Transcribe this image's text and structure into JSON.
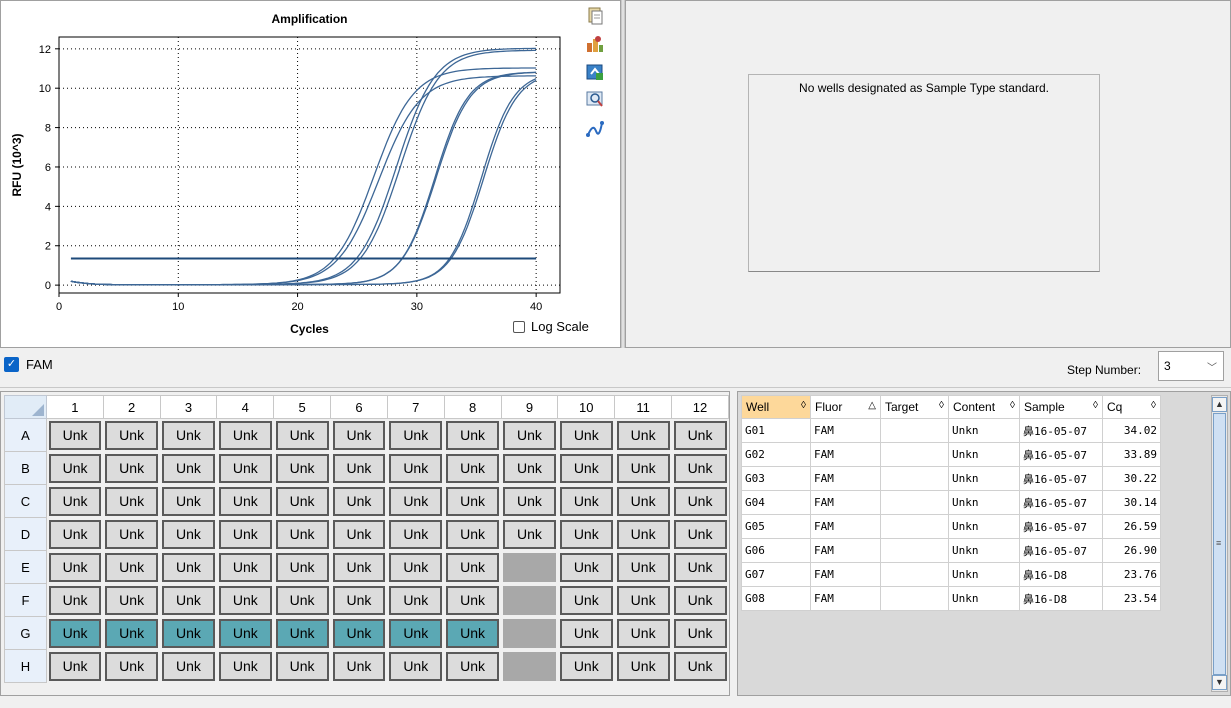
{
  "chart_data": {
    "type": "line",
    "title": "Amplification",
    "xlabel": "Cycles",
    "ylabel": "RFU (10^3)",
    "xlim": [
      0,
      42
    ],
    "ylim": [
      -0.4,
      12.6
    ],
    "xticks": [
      0,
      10,
      20,
      30,
      40
    ],
    "yticks": [
      0,
      2,
      4,
      6,
      8,
      10,
      12
    ],
    "grid": true,
    "threshold": 1.35,
    "series": [
      {
        "well": "G01",
        "cq": 34.02,
        "plateau": 10.8,
        "mid": 35.6,
        "k": 0.72
      },
      {
        "well": "G02",
        "cq": 33.89,
        "plateau": 10.8,
        "mid": 35.4,
        "k": 0.74
      },
      {
        "well": "G03",
        "cq": 30.22,
        "plateau": 10.8,
        "mid": 31.6,
        "k": 0.7
      },
      {
        "well": "G04",
        "cq": 30.14,
        "plateau": 10.8,
        "mid": 31.5,
        "k": 0.72
      },
      {
        "well": "G05",
        "cq": 26.59,
        "plateau": 12.0,
        "mid": 28.3,
        "k": 0.62
      },
      {
        "well": "G06",
        "cq": 26.9,
        "plateau": 11.9,
        "mid": 28.6,
        "k": 0.62
      },
      {
        "well": "G07",
        "cq": 23.76,
        "plateau": 11.0,
        "mid": 26.4,
        "k": 0.6
      },
      {
        "well": "G08",
        "cq": 23.54,
        "plateau": 10.6,
        "mid": 26.8,
        "k": 0.58
      }
    ],
    "colors": {
      "curve": "#3d6796",
      "threshold": "#1e4a7a",
      "grid": "#000000"
    }
  },
  "chart_panel": {
    "log_scale_label": "Log Scale",
    "log_scale_checked": false,
    "tool_icons": [
      "copy-icon",
      "export-icon",
      "refresh-icon",
      "zoom-icon",
      "curve-icon"
    ]
  },
  "standard_panel": {
    "message": "No wells designated as Sample Type standard."
  },
  "fluor_bar": {
    "fluor_label": "FAM",
    "fluor_checked": true,
    "step_label": "Step Number:",
    "step_value": "3"
  },
  "plate": {
    "columns": [
      "1",
      "2",
      "3",
      "4",
      "5",
      "6",
      "7",
      "8",
      "9",
      "10",
      "11",
      "12"
    ],
    "rows": [
      "A",
      "B",
      "C",
      "D",
      "E",
      "F",
      "G",
      "H"
    ],
    "well_label": "Unk",
    "empty_wells": [
      "E9",
      "F9",
      "G9",
      "H9"
    ],
    "selected_wells": [
      "G1",
      "G2",
      "G3",
      "G4",
      "G5",
      "G6",
      "G7",
      "G8"
    ],
    "colors": {
      "well": "#dcdcdc",
      "selected": "#5ba8b4",
      "empty": "#a8a8a8"
    }
  },
  "grid": {
    "headers": [
      {
        "label": "Well",
        "sort": "◊",
        "active": true
      },
      {
        "label": "Fluor",
        "sort": "△",
        "active": false
      },
      {
        "label": "Target",
        "sort": "◊",
        "active": false
      },
      {
        "label": "Content",
        "sort": "◊",
        "active": false
      },
      {
        "label": "Sample",
        "sort": "◊",
        "active": false
      },
      {
        "label": "Cq",
        "sort": "◊",
        "active": false
      }
    ],
    "rows": [
      {
        "well": "G01",
        "fluor": "FAM",
        "target": "",
        "content": "Unkn",
        "sample": "鼻16-05-07",
        "cq": "34.02"
      },
      {
        "well": "G02",
        "fluor": "FAM",
        "target": "",
        "content": "Unkn",
        "sample": "鼻16-05-07",
        "cq": "33.89"
      },
      {
        "well": "G03",
        "fluor": "FAM",
        "target": "",
        "content": "Unkn",
        "sample": "鼻16-05-07",
        "cq": "30.22"
      },
      {
        "well": "G04",
        "fluor": "FAM",
        "target": "",
        "content": "Unkn",
        "sample": "鼻16-05-07",
        "cq": "30.14"
      },
      {
        "well": "G05",
        "fluor": "FAM",
        "target": "",
        "content": "Unkn",
        "sample": "鼻16-05-07",
        "cq": "26.59"
      },
      {
        "well": "G06",
        "fluor": "FAM",
        "target": "",
        "content": "Unkn",
        "sample": "鼻16-05-07",
        "cq": "26.90"
      },
      {
        "well": "G07",
        "fluor": "FAM",
        "target": "",
        "content": "Unkn",
        "sample": "鼻16-D8",
        "cq": "23.76"
      },
      {
        "well": "G08",
        "fluor": "FAM",
        "target": "",
        "content": "Unkn",
        "sample": "鼻16-D8",
        "cq": "23.54"
      }
    ]
  }
}
